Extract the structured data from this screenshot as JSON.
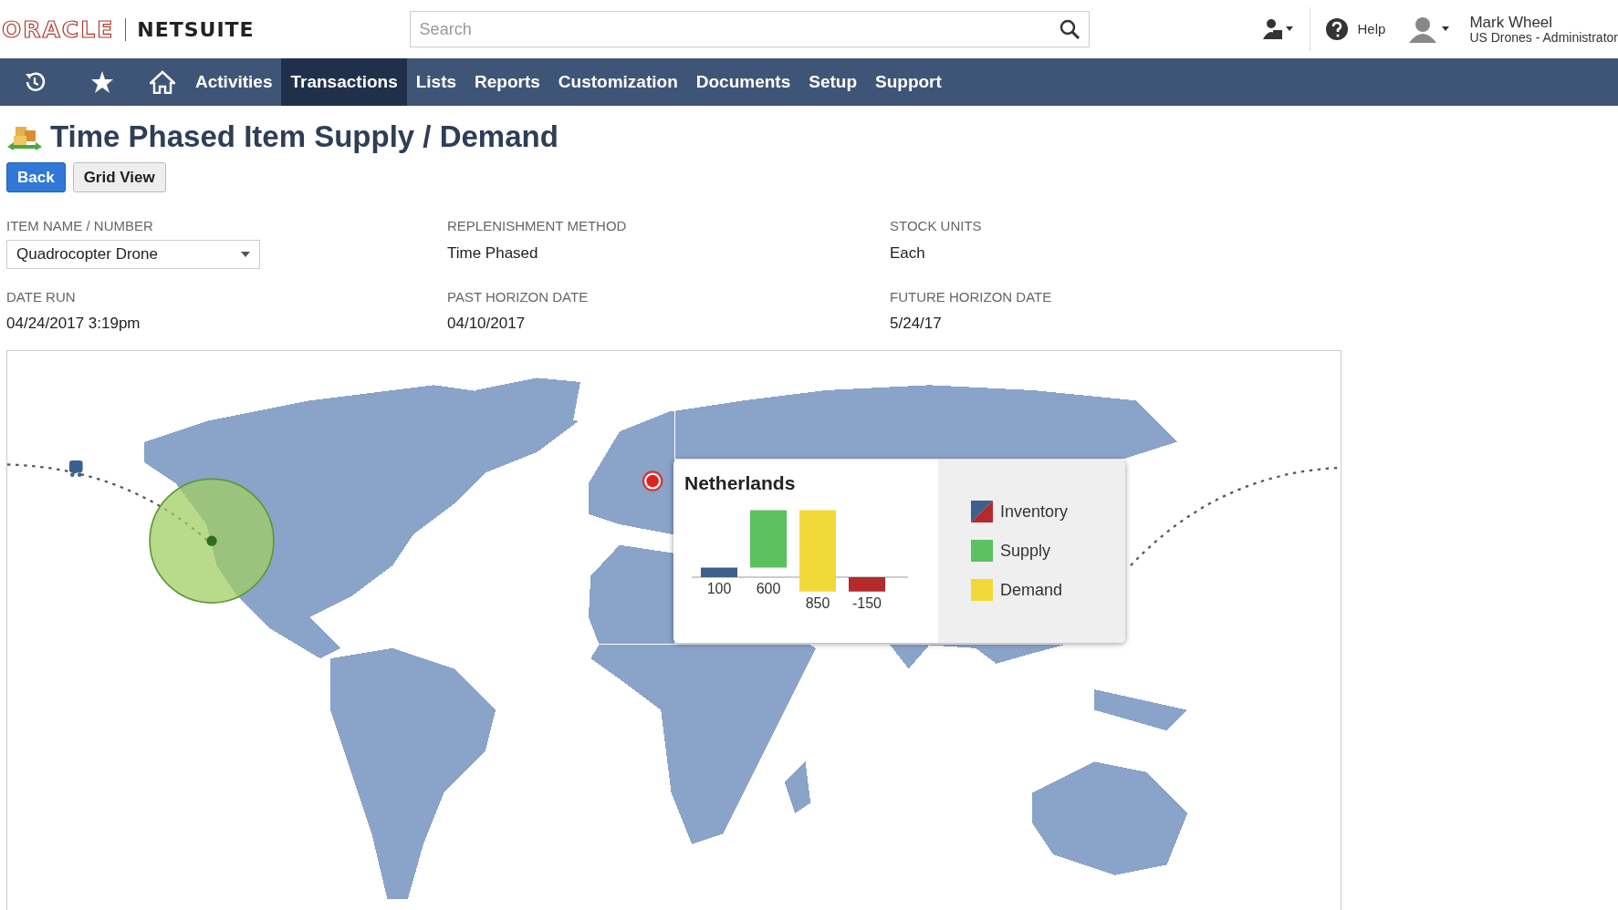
{
  "header": {
    "logo": {
      "brand": "ORACLE",
      "product": "NETSUITE"
    },
    "search": {
      "placeholder": "Search"
    },
    "help": "Help",
    "user": {
      "name": "Mark Wheel",
      "role": "US Drones - Administrator"
    }
  },
  "nav": {
    "items": [
      {
        "label": "Activities",
        "selected": false
      },
      {
        "label": "Transactions",
        "selected": true
      },
      {
        "label": "Lists",
        "selected": false
      },
      {
        "label": "Reports",
        "selected": false
      },
      {
        "label": "Customization",
        "selected": false
      },
      {
        "label": "Documents",
        "selected": false
      },
      {
        "label": "Setup",
        "selected": false
      },
      {
        "label": "Support",
        "selected": false
      }
    ]
  },
  "page": {
    "title": "Time Phased Item Supply / Demand",
    "buttons": [
      {
        "label": "Back",
        "kind": "primary"
      },
      {
        "label": "Grid View",
        "kind": "secondary"
      }
    ],
    "fields": [
      {
        "label": "ITEM NAME / NUMBER",
        "value": "Quadrocopter Drone",
        "kind": "select"
      },
      {
        "label": "REPLENISHMENT METHOD",
        "value": "Time Phased",
        "kind": "text"
      },
      {
        "label": "STOCK UNITS",
        "value": "Each",
        "kind": "text"
      },
      {
        "label": "DATE RUN",
        "value": "04/24/2017 3:19pm",
        "kind": "text"
      },
      {
        "label": "PAST HORIZON DATE",
        "value": "04/10/2017",
        "kind": "text"
      },
      {
        "label": "FUTURE HORIZON DATE",
        "value": "5/24/17",
        "kind": "text"
      }
    ]
  },
  "map": {
    "tooltip": {
      "title": "Netherlands",
      "bars": [
        {
          "reading": "100",
          "kind": "stock",
          "color": "#3d5f8d"
        },
        {
          "reading": "600",
          "kind": "in",
          "color": "#5cc15f"
        },
        {
          "reading": "850",
          "kind": "out",
          "color": "#f2d93a"
        },
        {
          "reading": "-150",
          "kind": "stock",
          "color": "#b52a2a"
        }
      ],
      "legend": [
        {
          "label": "Inventory",
          "kind": "stock"
        },
        {
          "label": "Supply",
          "kind": "in"
        },
        {
          "label": "Demand",
          "kind": "out"
        }
      ]
    }
  }
}
